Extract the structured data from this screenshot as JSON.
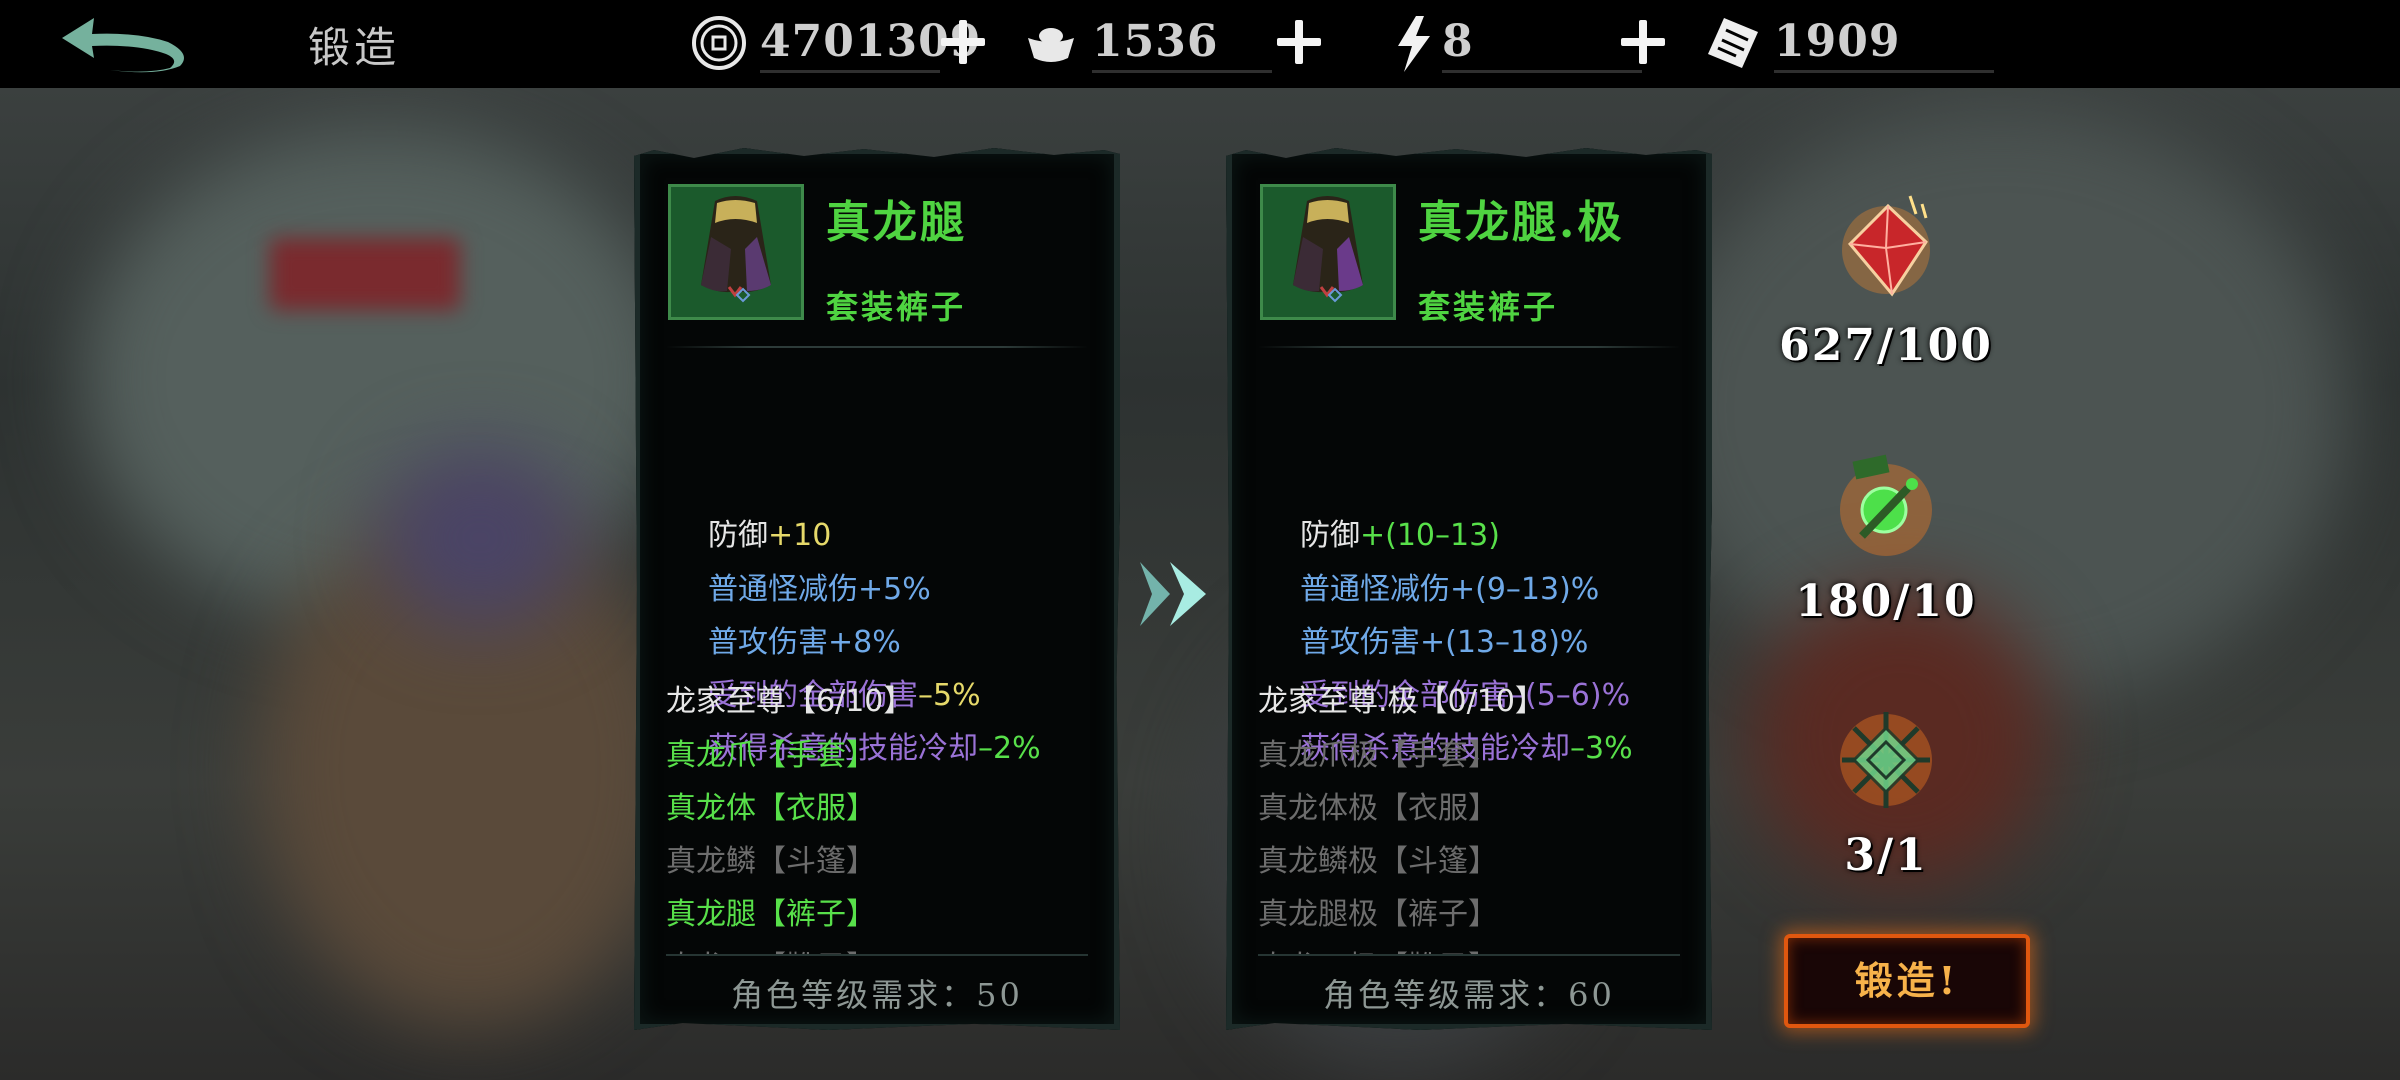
{
  "header": {
    "title": "锻造",
    "resources": [
      {
        "icon": "coin-icon",
        "value": "4701309"
      },
      {
        "icon": "ingot-icon",
        "value": "1536"
      },
      {
        "icon": "lightning-icon",
        "value": "8"
      },
      {
        "icon": "ticket-icon",
        "value": "1909"
      }
    ]
  },
  "current_item": {
    "name": "真龙腿",
    "type": "套装裤子",
    "stats": [
      {
        "label": "防御",
        "value": "+10",
        "label_color": "#e6e6e6",
        "value_color": "#e6d96a"
      },
      {
        "label": "普通怪减伤",
        "value": "+5%",
        "label_color": "#6fa9e8",
        "value_color": "#6fa9e8"
      },
      {
        "label": "普攻伤害",
        "value": "+8%",
        "label_color": "#6fa9e8",
        "value_color": "#6fa9e8"
      },
      {
        "label": "受到的全部伤害",
        "value": "–5%",
        "label_color": "#9a72d6",
        "value_color": "#e6d96a"
      },
      {
        "label": "获得杀意的技能冷却",
        "value": "–2%",
        "label_color": "#9a72d6",
        "value_color": "#58e04a"
      }
    ],
    "set_title": "龙家至尊【6/10】",
    "set_items": [
      {
        "text": "真龙爪【手套】",
        "active": true
      },
      {
        "text": "真龙体【衣服】",
        "active": true
      },
      {
        "text": "真龙鳞【斗篷】",
        "active": false
      },
      {
        "text": "真龙腿【裤子】",
        "active": true
      },
      {
        "text": "真龙云【靴子】",
        "active": false
      }
    ],
    "requirement": "角色等级需求：50"
  },
  "upgraded_item": {
    "name": "真龙腿.极",
    "type": "套装裤子",
    "stats": [
      {
        "label": "防御",
        "value": "+(10–13)",
        "label_color": "#e6e6e6",
        "value_color": "#58e04a"
      },
      {
        "label": "普通怪减伤",
        "value": "+(9–13)%",
        "label_color": "#6fa9e8",
        "value_color": "#6fa9e8"
      },
      {
        "label": "普攻伤害",
        "value": "+(13–18)%",
        "label_color": "#6fa9e8",
        "value_color": "#6fa9e8"
      },
      {
        "label": "受到的全部伤害",
        "value": "–(5–6)%",
        "label_color": "#9a72d6",
        "value_color": "#9a72d6"
      },
      {
        "label": "获得杀意的技能冷却",
        "value": "–3%",
        "label_color": "#9a72d6",
        "value_color": "#58e04a"
      }
    ],
    "set_title": "龙家至尊.极【0/10】",
    "set_items": [
      {
        "text": "真龙爪极【手套】",
        "active": false
      },
      {
        "text": "真龙体极【衣服】",
        "active": false
      },
      {
        "text": "真龙鳞极【斗篷】",
        "active": false
      },
      {
        "text": "真龙腿极【裤子】",
        "active": false
      },
      {
        "text": "真龙云极【靴子】",
        "active": false
      }
    ],
    "requirement": "角色等级需求：60"
  },
  "materials": [
    {
      "icon": "red-crystal-icon",
      "count": "627/100"
    },
    {
      "icon": "green-orb-icon",
      "count": "180/10"
    },
    {
      "icon": "spider-web-icon",
      "count": "3/1"
    }
  ],
  "forge_button": "锻造!"
}
